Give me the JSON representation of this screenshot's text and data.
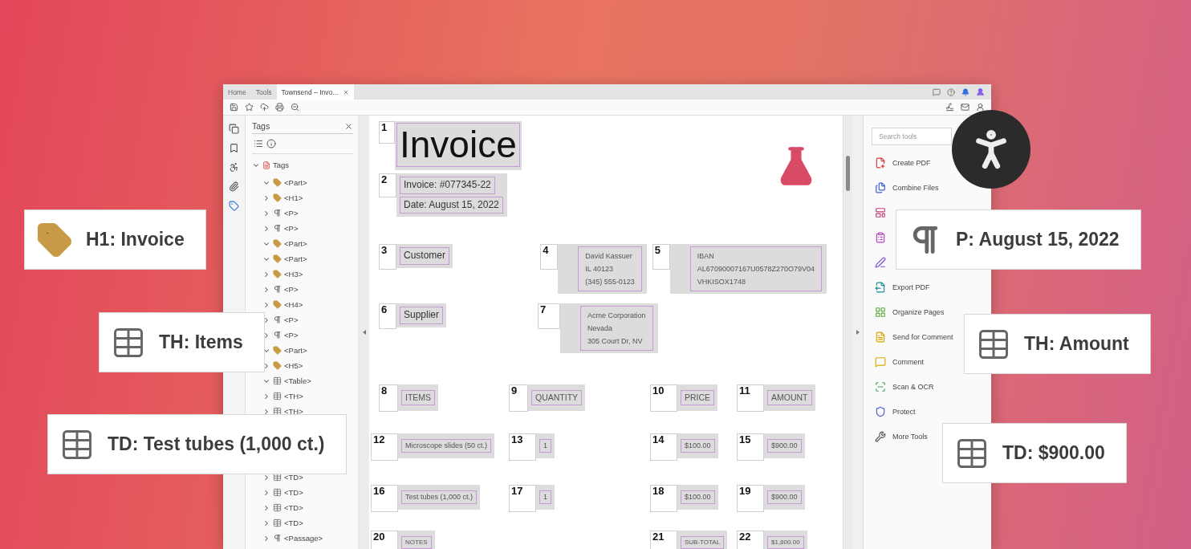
{
  "window": {
    "tabs": [
      {
        "label": "Home",
        "selected": false
      },
      {
        "label": "Tools",
        "selected": false
      },
      {
        "label": "Townsend – Invo...",
        "selected": true
      }
    ]
  },
  "left_rail": {
    "items": [
      {
        "selected": false
      },
      {
        "selected": false
      },
      {
        "selected": false
      },
      {
        "selected": false
      },
      {
        "selected": true
      }
    ]
  },
  "tags_panel": {
    "title": "Tags",
    "tree": {
      "label": "Tags",
      "expanded": true,
      "children": [
        {
          "label": "<Part>",
          "kind": "tag",
          "expanded": true
        },
        {
          "label": "<H1>",
          "kind": "tag",
          "expanded": false
        },
        {
          "label": "<P>",
          "kind": "paragraph",
          "expanded": false
        },
        {
          "label": "<P>",
          "kind": "paragraph",
          "expanded": false
        },
        {
          "label": "<Part>",
          "kind": "tag",
          "expanded": true
        },
        {
          "label": "<Part>",
          "kind": "tag",
          "expanded": true
        },
        {
          "label": "<H3>",
          "kind": "tag",
          "expanded": false
        },
        {
          "label": "<P>",
          "kind": "paragraph",
          "expanded": false
        },
        {
          "label": "<H4>",
          "kind": "tag",
          "expanded": false
        },
        {
          "label": "<P>",
          "kind": "paragraph",
          "expanded": false
        },
        {
          "label": "<P>",
          "kind": "paragraph",
          "expanded": false
        },
        {
          "label": "<Part>",
          "kind": "tag",
          "expanded": true
        },
        {
          "label": "<H5>",
          "kind": "tag",
          "expanded": false
        },
        {
          "label": "<Table>",
          "kind": "table",
          "expanded": true
        },
        {
          "label": "<TH>",
          "kind": "table",
          "expanded": false
        },
        {
          "label": "<TH>",
          "kind": "table",
          "expanded": false
        },
        {
          "label": "<TD>",
          "kind": "table",
          "expanded": false
        },
        {
          "label": "<TD>",
          "kind": "table",
          "expanded": false
        },
        {
          "label": "<TD>",
          "kind": "table",
          "expanded": false
        },
        {
          "label": "<TD>",
          "kind": "table",
          "expanded": false
        },
        {
          "label": "<Passage>",
          "kind": "paragraph",
          "expanded": false
        }
      ]
    }
  },
  "document": {
    "title": {
      "number": "1",
      "text": "Invoice"
    },
    "header": {
      "number": "2",
      "lines": [
        "Invoice: #077345-22",
        "Date: August 15, 2022"
      ]
    },
    "parties": [
      {
        "number": "3",
        "label": "Customer",
        "address_number": "4",
        "address": [
          "David Kassuer",
          "IL 40123",
          "(345) 555-0123"
        ],
        "extra_number": "5",
        "extra": [
          "IBAN",
          "AL67090007167U0578Z270O79V04",
          "VHKISOX1748"
        ]
      },
      {
        "number": "6",
        "label": "Supplier",
        "address_number": "7",
        "address": [
          "Acme Corporation",
          "Nevada",
          "305 Court Dr, NV"
        ]
      }
    ],
    "table": {
      "header": [
        {
          "number": "8",
          "text": "ITEMS"
        },
        {
          "number": "9",
          "text": "QUANTITY"
        },
        {
          "number": "10",
          "text": "PRICE"
        },
        {
          "number": "11",
          "text": "AMOUNT"
        }
      ],
      "rows": [
        [
          {
            "number": "12",
            "text": "Microscope slides (50 ct.)"
          },
          {
            "number": "13",
            "text": "1"
          },
          {
            "number": "14",
            "text": "$100.00"
          },
          {
            "number": "15",
            "text": "$900.00"
          }
        ],
        [
          {
            "number": "16",
            "text": "Test tubes (1,000 ct.)"
          },
          {
            "number": "17",
            "text": "1"
          },
          {
            "number": "18",
            "text": "$100.00"
          },
          {
            "number": "19",
            "text": "$900.00"
          }
        ]
      ],
      "footer": {
        "notes": {
          "number": "20",
          "text": "NOTES"
        },
        "subtotal_label": {
          "number": "21",
          "text": "SUB-TOTAL"
        },
        "subtotal": {
          "number": "22",
          "text": "$1,800.00"
        }
      }
    }
  },
  "tools": {
    "search": {
      "placeholder": "Search tools"
    },
    "items": [
      {
        "kind": "labeled",
        "label": "Create PDF"
      },
      {
        "kind": "labeled",
        "label": "Combine Files"
      },
      {
        "kind": "icon"
      },
      {
        "kind": "icon"
      },
      {
        "kind": "icon"
      },
      {
        "kind": "labeled",
        "label": "Export PDF"
      },
      {
        "kind": "labeled",
        "label": "Organize Pages"
      },
      {
        "kind": "labeled",
        "label": "Send for Comment"
      },
      {
        "kind": "labeled",
        "label": "Comment"
      },
      {
        "kind": "labeled",
        "label": "Scan & OCR"
      },
      {
        "kind": "labeled",
        "label": "Protect"
      },
      {
        "kind": "labeled",
        "label": "More Tools"
      }
    ]
  },
  "callouts": [
    {
      "kind": "tag",
      "text": "H1: Invoice"
    },
    {
      "kind": "table",
      "text": "TH: Items"
    },
    {
      "kind": "table",
      "text": "TD: Test tubes (1,000 ct.)"
    },
    {
      "kind": "paragraph",
      "text": "P: August 15, 2022"
    },
    {
      "kind": "table",
      "text": "TH: Amount"
    },
    {
      "kind": "table",
      "text": "TD: $900.00"
    }
  ]
}
